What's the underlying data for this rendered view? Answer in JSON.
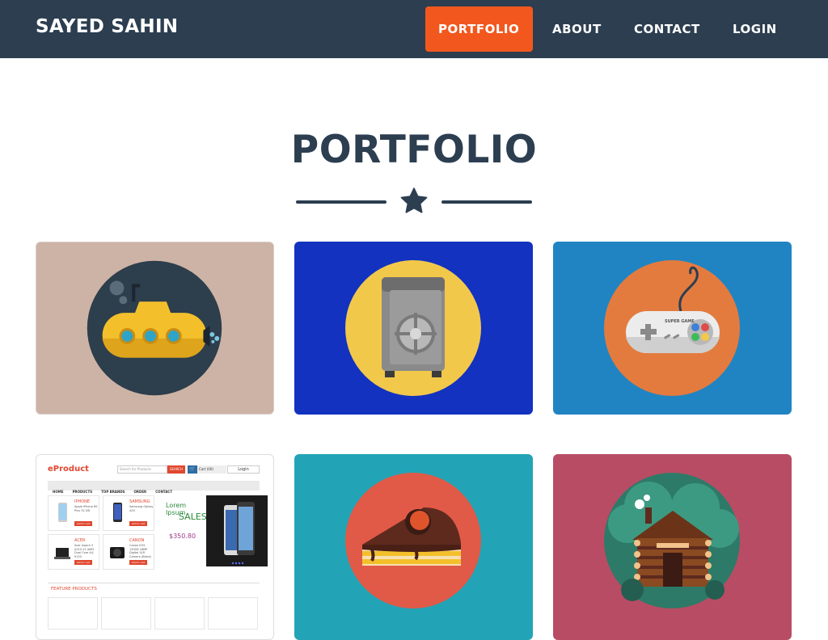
{
  "brand": "SAYED SAHIN",
  "nav": {
    "portfolio": "PORTFOLIO",
    "about": "ABOUT",
    "contact": "CONTACT",
    "login": "LOGIN"
  },
  "section": {
    "title": "PORTFOLIO"
  },
  "colors": {
    "navbar": "#2c3e50",
    "accent": "#f2581e",
    "heading": "#2c3e50"
  },
  "portfolio_items": [
    {
      "icon": "submarine-icon",
      "bg": "#cdb3a6"
    },
    {
      "icon": "safe-icon",
      "bg": "#1232bf"
    },
    {
      "icon": "game-controller-icon",
      "bg": "#2184c2"
    },
    {
      "icon": "eproduct-screenshot",
      "bg": "#ffffff"
    },
    {
      "icon": "cake-icon",
      "bg": "#22a4b6"
    },
    {
      "icon": "log-cabin-icon",
      "bg": "#b84c64"
    }
  ],
  "controller_label": "SUPER GAME",
  "shop": {
    "logo": "eProduct",
    "search_placeholder": "Search for Products",
    "search_button": "SEARCH",
    "cart": "Cart (00)",
    "login": "Login",
    "menu": [
      "HOME",
      "PRODUCTS",
      "TOP BRANDS",
      "ORDER",
      "CONTACT"
    ],
    "products": [
      {
        "name": "IPHONE",
        "desc": "Apple iPhone 6S Plus 32 GB",
        "button": "Add to cart"
      },
      {
        "name": "SAMSUNG",
        "desc": "Samsung Galaxy A20",
        "button": "Add to cart"
      },
      {
        "name": "ACER",
        "desc": "Acer Aspire 3 A315-21 AMD Dual Core A4-9120",
        "button": "Add to cart"
      },
      {
        "name": "CANON",
        "desc": "Canon EOS 1300D 18MP Digital SLR Camera (Black)",
        "button": "Add to cart"
      }
    ],
    "promo_line1": "Lorem Ipsum",
    "promo_line2": "SALES",
    "promo_price": "$350.80",
    "feature_title": "FEATURE PRODUCTS"
  }
}
